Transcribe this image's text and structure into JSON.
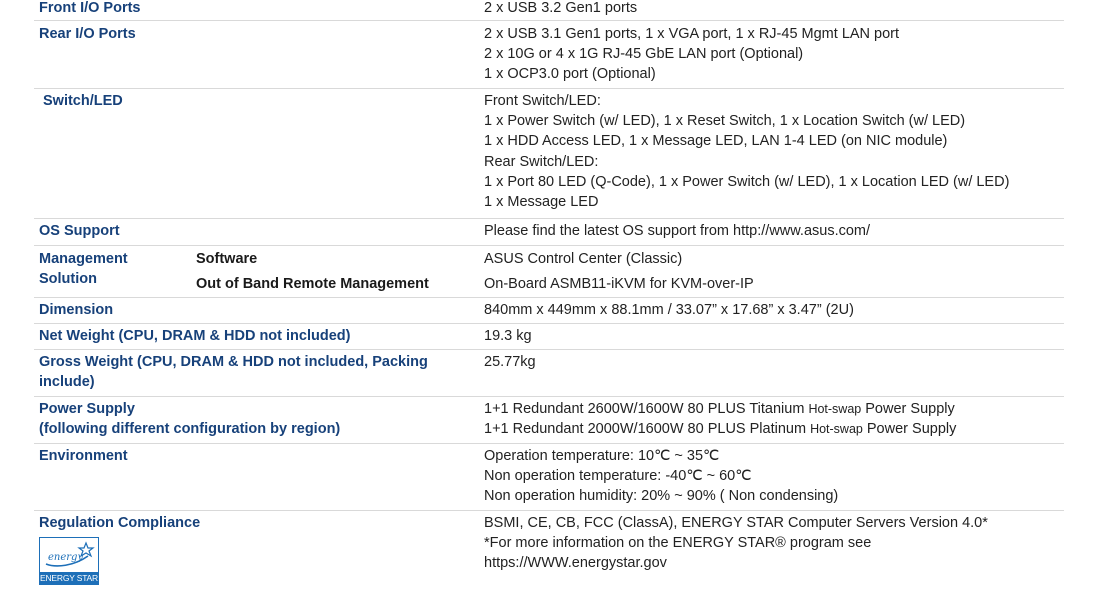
{
  "rows": [
    {
      "label": "Front I/O Ports",
      "values": [
        "2 x USB 3.2 Gen1 ports"
      ]
    },
    {
      "label": "Rear I/O Ports",
      "values": [
        "2 x USB 3.1 Gen1 ports, 1 x VGA port, 1 x RJ-45 Mgmt LAN port",
        "2 x 10G or 4 x 1G RJ-45 GbE LAN port (Optional)",
        "1 x OCP3.0 port (Optional)"
      ]
    },
    {
      "label": "Switch/LED",
      "values": [
        "Front Switch/LED:",
        "1 x Power Switch (w/ LED), 1 x Reset Switch, 1 x Location Switch (w/ LED)",
        "1 x HDD Access LED, 1 x Message LED, LAN 1-4 LED (on NIC module)",
        "Rear Switch/LED:",
        "1 x Port 80 LED (Q-Code), 1 x Power Switch (w/ LED), 1 x Location LED (w/ LED)",
        "1 x Message LED"
      ]
    },
    {
      "label": "OS Support",
      "values": [
        "Please find the latest OS support from http://www.asus.com/"
      ]
    },
    {
      "label_lines": [
        "Management",
        "Solution"
      ],
      "sub_rows": [
        {
          "label": "Software",
          "value": "ASUS Control Center (Classic)"
        },
        {
          "label": "Out of Band Remote Management",
          "value": "On-Board ASMB11-iKVM for KVM-over-IP"
        }
      ]
    },
    {
      "label": "Dimension",
      "values": [
        "840mm x 449mm x 88.1mm / 33.07” x 17.68” x 3.47” (2U)"
      ]
    },
    {
      "label": "Net Weight (CPU, DRAM & HDD not included)",
      "values": [
        "19.3 kg"
      ]
    },
    {
      "label_lines": [
        "Gross Weight (CPU, DRAM & HDD not included, Packing",
        "include)"
      ],
      "values": [
        "25.77kg"
      ]
    },
    {
      "label_lines": [
        "Power Supply",
        "(following different configuration by region)"
      ],
      "psu": [
        {
          "pre": "1+1 Redundant 2600W/1600W 80 PLUS Titanium ",
          "small": "Hot-swap",
          "post": " Power Supply"
        },
        {
          "pre": "1+1 Redundant 2000W/1600W 80 PLUS Platinum ",
          "small": "Hot-swap",
          "post": " Power Supply"
        }
      ]
    },
    {
      "label": "Environment",
      "values": [
        "Operation temperature: 10℃ ~ 35℃",
        "Non operation temperature: -40℃ ~ 60℃",
        "Non operation humidity: 20% ~ 90% ( Non condensing)"
      ]
    },
    {
      "label": "Regulation Compliance",
      "logo_text": "ENERGY STAR",
      "values": [
        "BSMI, CE, CB, FCC (ClassA), ENERGY STAR Computer Servers Version 4.0*",
        "*For more information on the ENERGY STAR® program see",
        "https://WWW.energystar.gov"
      ]
    }
  ],
  "colors": {
    "label": "#17417a",
    "energy_star_blue": "#1d6fb8"
  }
}
